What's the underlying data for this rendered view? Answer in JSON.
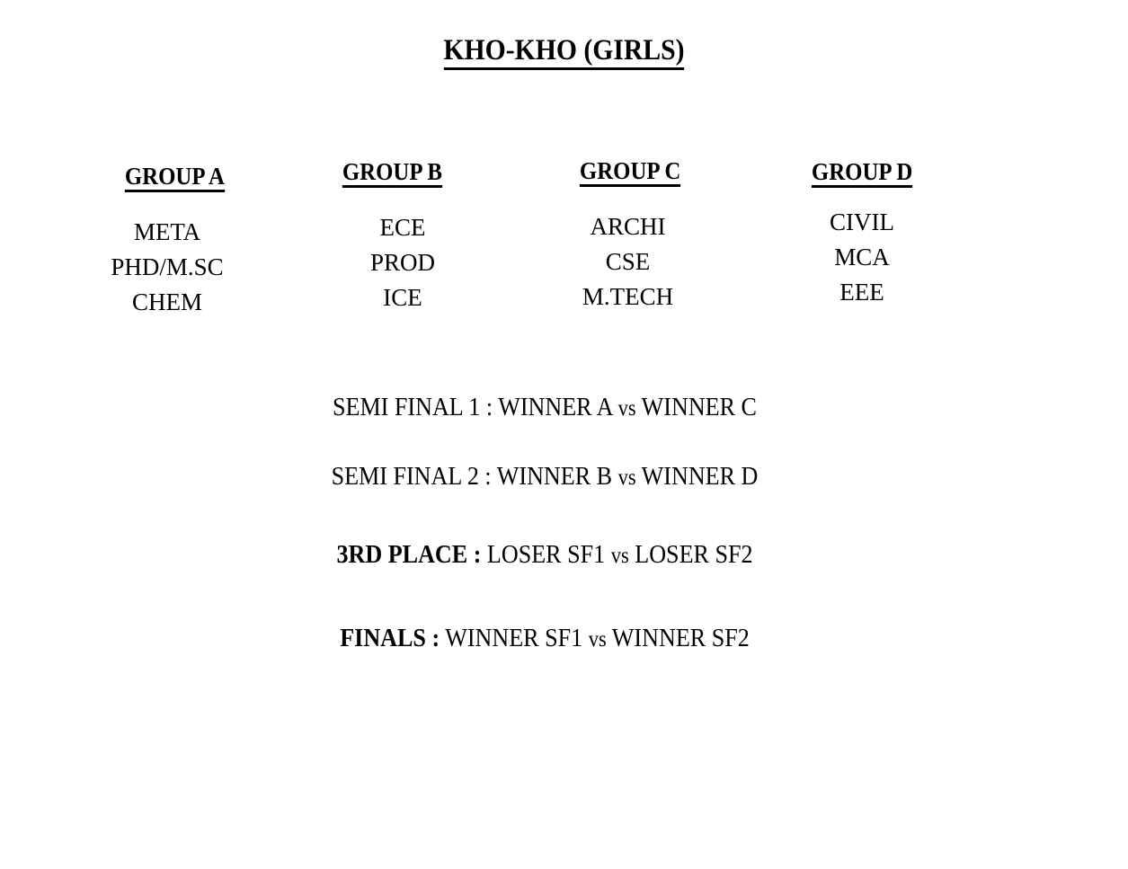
{
  "title": "KHO-KHO (GIRLS)",
  "groups": [
    {
      "heading": "GROUP A",
      "members": [
        "META",
        "PHD/M.SC",
        "CHEM"
      ]
    },
    {
      "heading": "GROUP B",
      "members": [
        "ECE",
        "PROD",
        "ICE"
      ]
    },
    {
      "heading": "GROUP C",
      "members": [
        "ARCHI",
        "CSE",
        "M.TECH"
      ]
    },
    {
      "heading": "GROUP D",
      "members": [
        "CIVIL",
        "MCA",
        "EEE"
      ]
    }
  ],
  "fixtures": {
    "semi_final_1": {
      "label": "SEMI FINAL 1 :",
      "team1": "WINNER A",
      "vs": "vs",
      "team2": "WINNER C"
    },
    "semi_final_2": {
      "label": "SEMI FINAL 2 :",
      "team1": "WINNER B",
      "vs": "vs",
      "team2": "WINNER D"
    },
    "third_place": {
      "label": "3RD PLACE :",
      "team1": "LOSER SF1",
      "vs": "vs",
      "team2": "LOSER SF2"
    },
    "finals": {
      "label": "FINALS :",
      "team1": "WINNER SF1",
      "vs": "vs",
      "team2": "WINNER SF2"
    }
  }
}
